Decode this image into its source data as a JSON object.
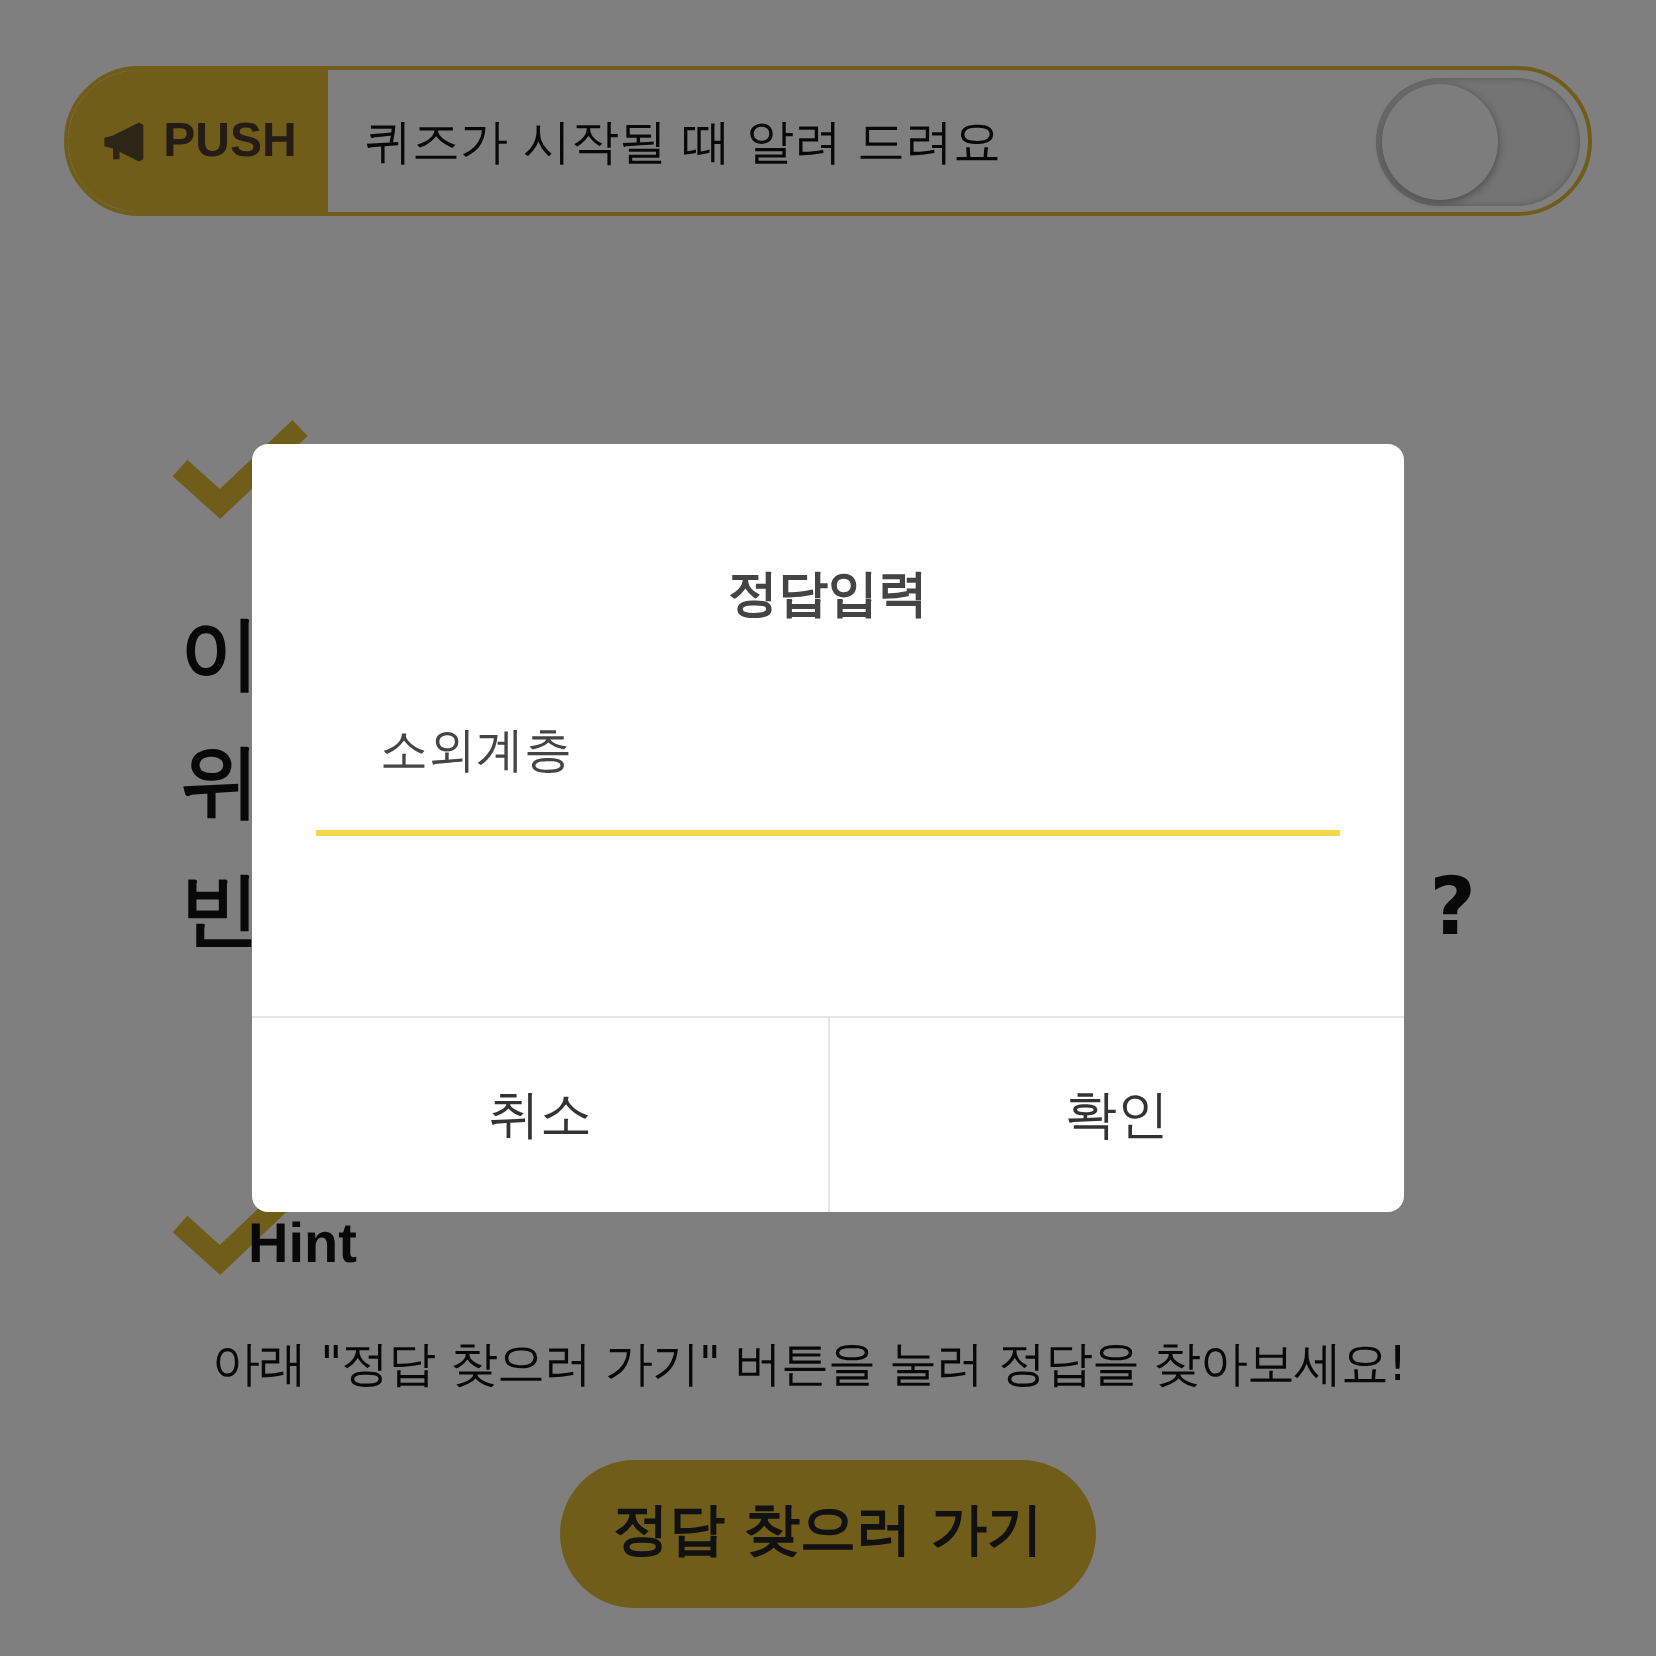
{
  "push_bar": {
    "badge": "PUSH",
    "text": "퀴즈가 시작될 때 알려 드려요",
    "toggle": {
      "on": false
    }
  },
  "question": {
    "lines": [
      {
        "left": "이"
      },
      {
        "left": "위"
      },
      {
        "left": "빈",
        "right": "?"
      }
    ]
  },
  "hint": {
    "title": "Hint",
    "text": " 아래 \"정답 찾으러 가기\" 버튼을 눌러 정답을 찾아보세요!"
  },
  "find_answer_button": "정답 찾으러 가기",
  "dialog": {
    "title": "정답입력",
    "input": {
      "value": "소외계층"
    },
    "buttons": [
      "취소",
      "확인"
    ]
  }
}
